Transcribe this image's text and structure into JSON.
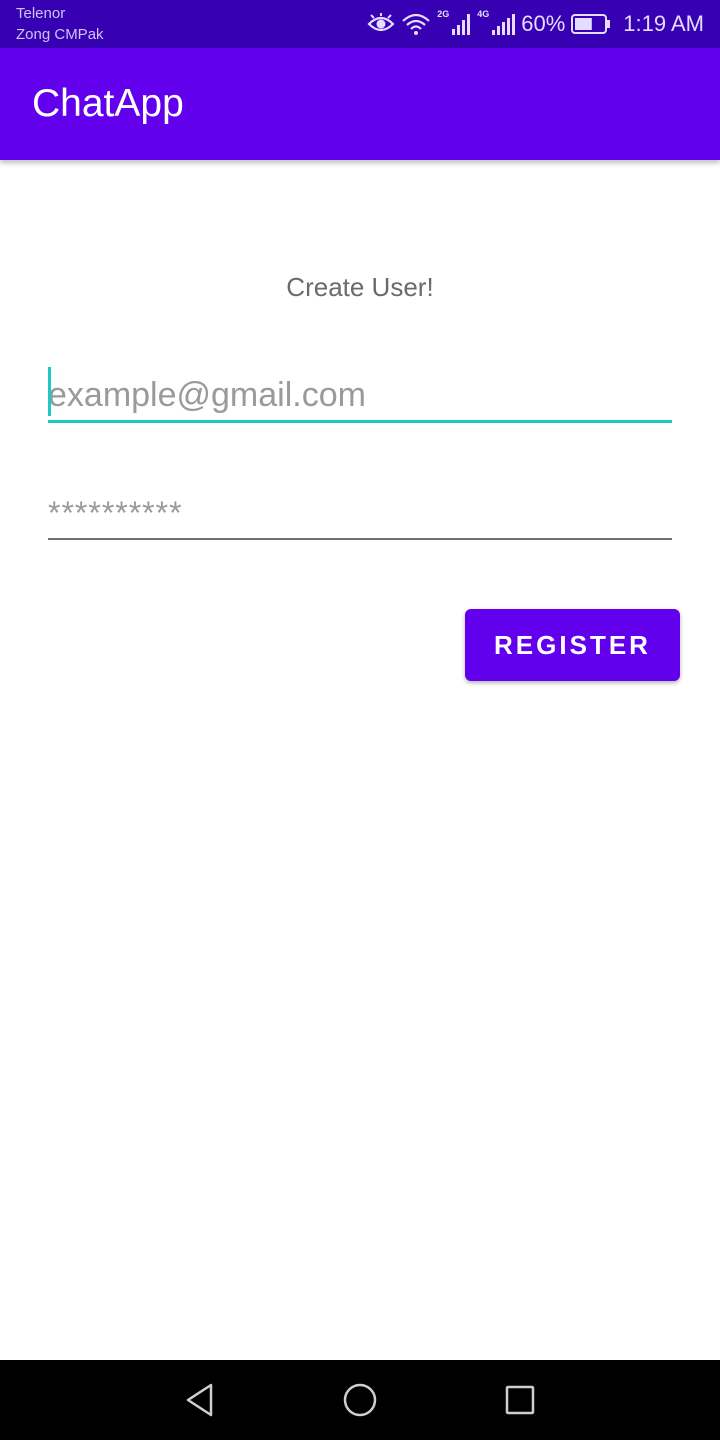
{
  "status_bar": {
    "carrier_1": "Telenor",
    "carrier_2": "Zong CMPak",
    "net_label_1": "2G",
    "net_label_2": "4G",
    "battery": "60%",
    "battery_level": 0.6,
    "time": "1:19 AM",
    "icons": [
      "eye-icon",
      "wifi-icon",
      "signal-2g-icon",
      "signal-4g-icon",
      "battery-icon"
    ],
    "background": "#3700b3"
  },
  "app_bar": {
    "title": "ChatApp",
    "background": "#6200ee"
  },
  "form": {
    "heading": "Create User!",
    "email": {
      "value": "",
      "placeholder": "example@gmail.com",
      "accent": "#1fc9c1"
    },
    "password": {
      "value": "",
      "placeholder": "**********"
    },
    "register_label": "REGISTER"
  },
  "nav_bar": {
    "buttons": [
      "back-icon",
      "home-icon",
      "recents-icon"
    ]
  }
}
